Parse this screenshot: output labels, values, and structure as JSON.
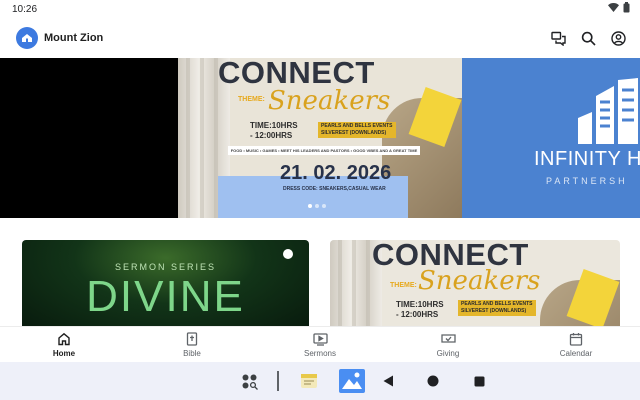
{
  "status_bar": {
    "time": "10:26",
    "icons": [
      "wifi-icon",
      "battery-icon"
    ]
  },
  "app_bar": {
    "title": "Mount Zion",
    "logo_color": "#3d7ae0",
    "actions": [
      "chat-icon",
      "search-icon",
      "account-icon"
    ]
  },
  "carousel": {
    "active_index": 0,
    "dot_count": 3,
    "main_poster": {
      "headline": "CONNECT",
      "theme_label": "THEME:",
      "theme": "Sneakers",
      "time_label": "TIME:",
      "time_start": "10HRS",
      "time_end": "- 12:00HRS",
      "venue_line1": "PEARLS AND BELLS EVENTS",
      "venue_line2": "SILVEREST (DOWNLANDS)",
      "ribbon": "FOOD • MUSIC • GAMES • MEET HIS LEADERS AND PASTORS • GOOD VIBES AND A GREAT TIME",
      "date": "21. 02. 2026",
      "dress_code": "DRESS CODE: SNEAKERS,CASUAL WEAR"
    },
    "right_poster": {
      "title": "INFINITY HO",
      "subtitle": "PARTNERSH"
    }
  },
  "cards": [
    {
      "series": "SERMON SERIES",
      "title": "DIVINE"
    },
    {
      "headline": "CONNECT",
      "theme_label": "THEME:",
      "theme": "Sneakers",
      "time_label": "TIME:",
      "time_start": "10HRS",
      "time_end": "- 12:00HRS",
      "venue_line1": "PEARLS AND BELLS EVENTS",
      "venue_line2": "SILVEREST (DOWNLANDS)"
    }
  ],
  "bottom_nav": [
    {
      "label": "Home",
      "icon": "home-icon",
      "active": true
    },
    {
      "label": "Bible",
      "icon": "bible-icon",
      "active": false
    },
    {
      "label": "Sermons",
      "icon": "sermons-icon",
      "active": false
    },
    {
      "label": "Giving",
      "icon": "giving-icon",
      "active": false
    },
    {
      "label": "Calendar",
      "icon": "calendar-icon",
      "active": false
    }
  ],
  "system_nav": [
    "app-drawer-icon",
    "notes-app-icon",
    "gallery-app-icon",
    "back-icon",
    "home-circle-icon",
    "recents-icon"
  ]
}
